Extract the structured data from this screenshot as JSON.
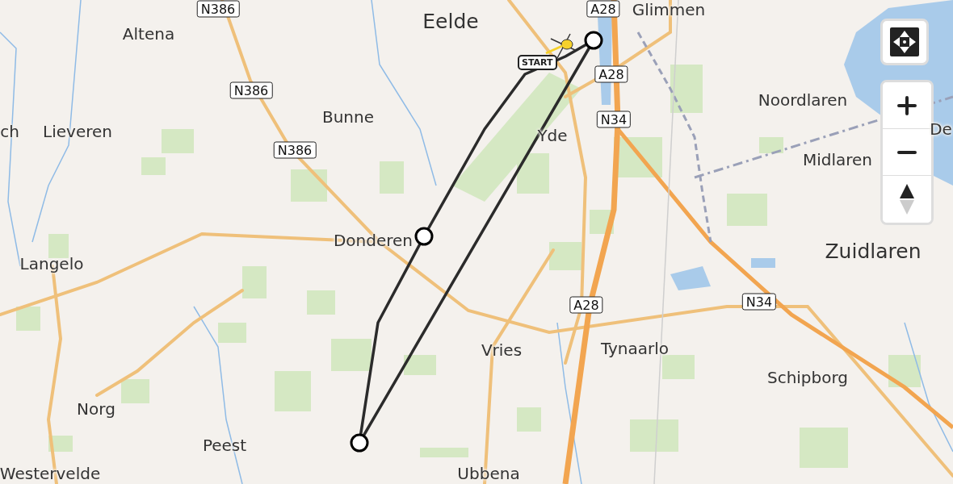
{
  "map": {
    "places": [
      {
        "name": "Eelde",
        "kind": "town"
      },
      {
        "name": "Altena",
        "kind": "village"
      },
      {
        "name": "Bunne",
        "kind": "village"
      },
      {
        "name": "ch",
        "kind": "village"
      },
      {
        "name": "Lieveren",
        "kind": "village"
      },
      {
        "name": "Langelo",
        "kind": "village"
      },
      {
        "name": "Donderen",
        "kind": "village"
      },
      {
        "name": "Norg",
        "kind": "village"
      },
      {
        "name": "Peest",
        "kind": "village"
      },
      {
        "name": "Westervelde",
        "kind": "village"
      },
      {
        "name": "Vries",
        "kind": "village"
      },
      {
        "name": "Tynaarlo",
        "kind": "village"
      },
      {
        "name": "Yde",
        "kind": "village"
      },
      {
        "name": "Noordlaren",
        "kind": "village"
      },
      {
        "name": "Midlaren",
        "kind": "village"
      },
      {
        "name": "De",
        "kind": "village"
      },
      {
        "name": "Zuidlaren",
        "kind": "town"
      },
      {
        "name": "Schipborg",
        "kind": "village"
      },
      {
        "name": "Glimmen",
        "kind": "village"
      },
      {
        "name": "Ubbena",
        "kind": "village"
      }
    ],
    "road_shields": [
      "N386",
      "N386",
      "N386",
      "A28",
      "A28",
      "N34",
      "A28",
      "N34"
    ],
    "start_label": "START"
  }
}
